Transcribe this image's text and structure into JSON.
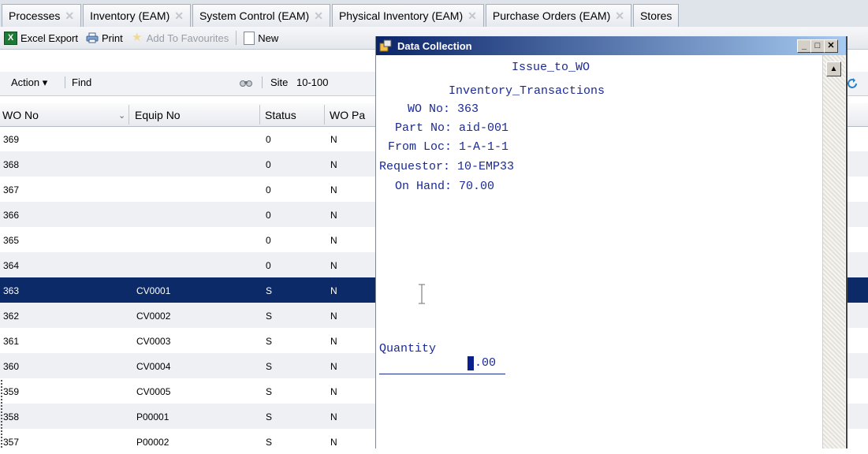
{
  "tabs": [
    {
      "label": "Processes"
    },
    {
      "label": "Inventory (EAM)"
    },
    {
      "label": "System Control (EAM)"
    },
    {
      "label": "Physical Inventory (EAM)"
    },
    {
      "label": "Purchase Orders (EAM)"
    },
    {
      "label": "Stores"
    }
  ],
  "toolbar": {
    "excel_label": "Excel Export",
    "print_label": "Print",
    "favourites_label": "Add To Favourites",
    "new_label": "New"
  },
  "filter": {
    "action_label": "Action ▾",
    "find_label": "Find",
    "find_value": "",
    "site_label": "Site",
    "site_value": "10-100"
  },
  "columns": {
    "wo_no": "WO No",
    "equip_no": "Equip No",
    "status": "Status",
    "wo_part": "WO Pa"
  },
  "rows": [
    {
      "wo": "369",
      "equip": "",
      "status": "0",
      "part": "N"
    },
    {
      "wo": "368",
      "equip": "",
      "status": "0",
      "part": "N"
    },
    {
      "wo": "367",
      "equip": "",
      "status": "0",
      "part": "N"
    },
    {
      "wo": "366",
      "equip": "",
      "status": "0",
      "part": "N"
    },
    {
      "wo": "365",
      "equip": "",
      "status": "0",
      "part": "N"
    },
    {
      "wo": "364",
      "equip": "",
      "status": "0",
      "part": "N"
    },
    {
      "wo": "363",
      "equip": "CV0001",
      "status": "S",
      "part": "N"
    },
    {
      "wo": "362",
      "equip": "CV0002",
      "status": "S",
      "part": "N"
    },
    {
      "wo": "361",
      "equip": "CV0003",
      "status": "S",
      "part": "N"
    },
    {
      "wo": "360",
      "equip": "CV0004",
      "status": "S",
      "part": "N"
    },
    {
      "wo": "359",
      "equip": "CV0005",
      "status": "S",
      "part": "N"
    },
    {
      "wo": "358",
      "equip": "P00001",
      "status": "S",
      "part": "N"
    },
    {
      "wo": "357",
      "equip": "P00002",
      "status": "S",
      "part": "N"
    }
  ],
  "popup": {
    "title": "Data Collection",
    "line1": "Issue_to_WO",
    "line2": "Inventory_Transactions",
    "wo_line": "WO No: 363",
    "part_line": "Part No: aid-001",
    "from_line": "From Loc: 1-A-1-1",
    "req_line": "Requestor: 10-EMP33",
    "onhand_line": "On Hand: 70.00",
    "qty_label": "Quantity",
    "qty_value": ".00"
  },
  "colors": {
    "selected_row": "#0c2a67",
    "title_gradient_start": "#0a246a",
    "terminal_text": "#1b2a92"
  }
}
